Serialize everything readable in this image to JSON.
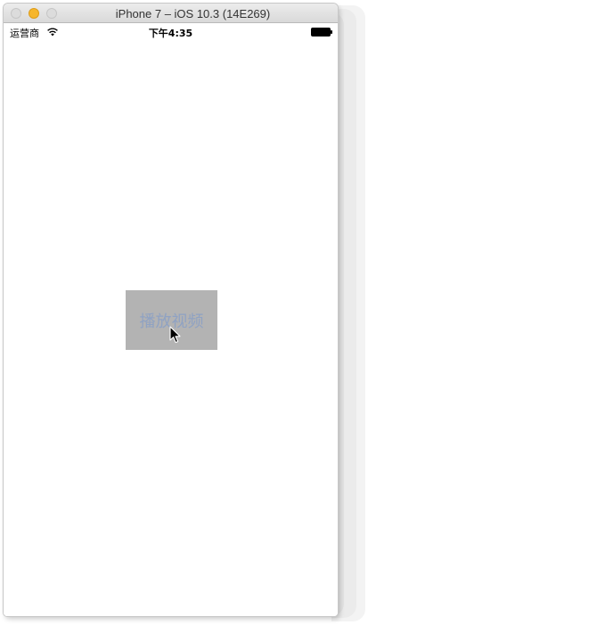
{
  "window": {
    "title": "iPhone 7 – iOS 10.3 (14E269)"
  },
  "status_bar": {
    "carrier": "运营商",
    "time": "下午4:35",
    "wifi_icon": "wifi-icon",
    "battery_icon": "battery-icon"
  },
  "main": {
    "play_button_label": "播放视频",
    "play_button_bg": "#b3b3b3",
    "play_button_text_color": "#8fa2c3"
  },
  "cursor": {
    "icon": "arrow-cursor-icon"
  }
}
